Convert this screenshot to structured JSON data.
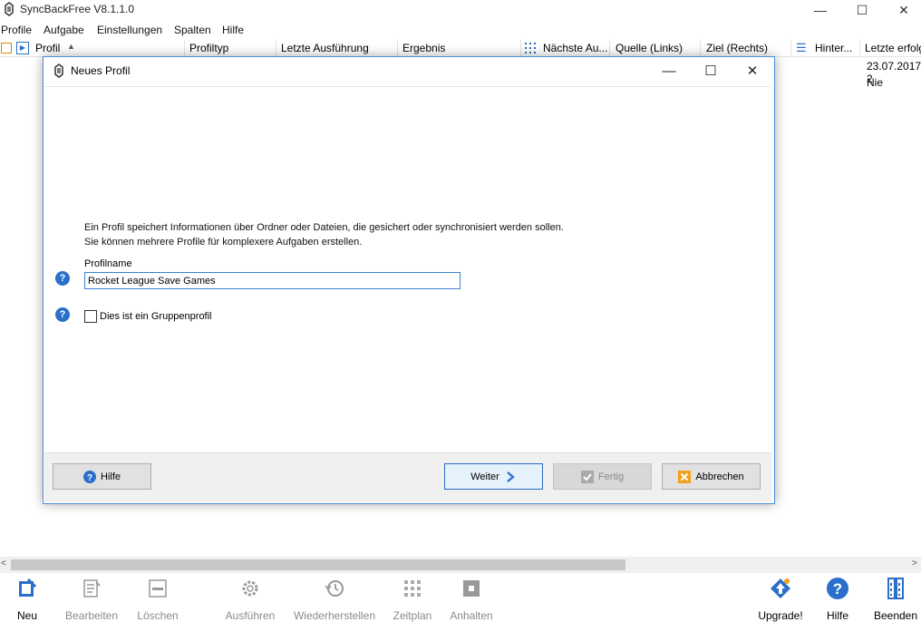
{
  "window": {
    "title": "SyncBackFree V8.1.1.0"
  },
  "menu": [
    "Profile",
    "Aufgabe",
    "Einstellungen",
    "Spalten",
    "Hilfe"
  ],
  "columns": [
    "Profil",
    "Profiltyp",
    "Letzte Ausführung",
    "Ergebnis",
    "Nächste Au...",
    "Quelle (Links)",
    "Ziel (Rechts)",
    "Hinter...",
    "Letzte erfolg"
  ],
  "rows": [
    "23.07.2017 2",
    "Nie"
  ],
  "toolbar": [
    {
      "label": "Neu",
      "icon": "new-profile-icon",
      "enabled": true
    },
    {
      "label": "Bearbeiten",
      "icon": "edit-icon",
      "enabled": false
    },
    {
      "label": "Löschen",
      "icon": "delete-icon",
      "enabled": false
    },
    {
      "label": "Ausführen",
      "icon": "run-gear-icon",
      "enabled": false
    },
    {
      "label": "Wiederherstellen",
      "icon": "restore-icon",
      "enabled": false
    },
    {
      "label": "Zeitplan",
      "icon": "schedule-grid-icon",
      "enabled": false
    },
    {
      "label": "Anhalten",
      "icon": "stop-icon",
      "enabled": false
    },
    {
      "label": "Upgrade!",
      "icon": "upgrade-icon",
      "enabled": true
    },
    {
      "label": "Hilfe",
      "icon": "help-icon",
      "enabled": true
    },
    {
      "label": "Beenden",
      "icon": "exit-icon",
      "enabled": true
    }
  ],
  "dialog": {
    "title": "Neues Profil",
    "description_line1": "Ein Profil speichert Informationen über Ordner oder Dateien, die gesichert oder synchronisiert werden sollen.",
    "description_line2": "Sie können mehrere Profile für komplexere Aufgaben erstellen.",
    "profile_name_label": "Profilname",
    "profile_name_value": "Rocket League Save Games",
    "group_profile_label": "Dies ist ein Gruppenprofil",
    "group_profile_checked": false,
    "buttons": {
      "help": "Hilfe",
      "next": "Weiter",
      "finish": "Fertig",
      "cancel": "Abbrechen"
    }
  },
  "colors": {
    "accent": "#2a6fc9",
    "dialog_border": "#4a90d9",
    "cancel_icon": "#f0a020"
  }
}
